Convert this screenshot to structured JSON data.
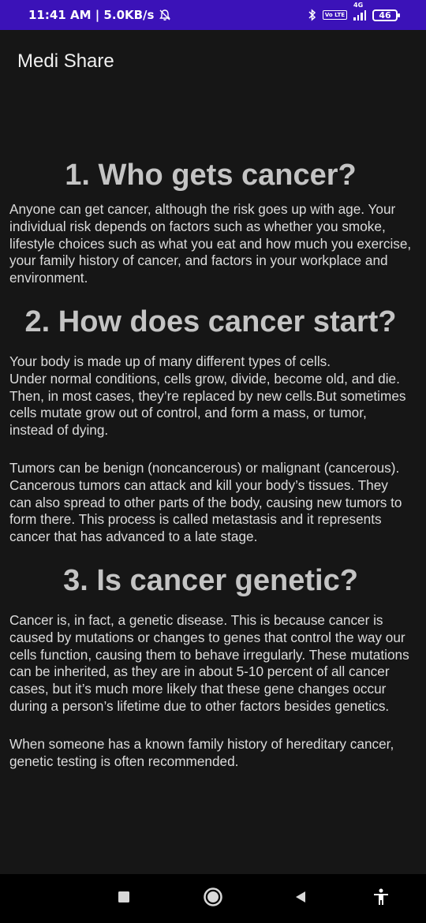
{
  "status_bar": {
    "time_speed": "11:41 AM | 5.0KB/s",
    "volte": "Vo LTE",
    "network": "4G",
    "battery": "46"
  },
  "app": {
    "title": "Medi Share"
  },
  "sections": [
    {
      "heading": "1. Who gets cancer?",
      "paragraphs": [
        "Anyone can get cancer, although the risk goes up with age. Your individual risk depends on factors such as whether you smoke, lifestyle choices such as what you eat and how much you exercise, your family history of cancer, and factors in your workplace and environment."
      ]
    },
    {
      "heading": "2. How does cancer start?",
      "paragraphs": [
        "Your body is made up of many different types of cells.\nUnder normal conditions, cells grow, divide, become old, and die. Then, in most cases, they’re replaced by new cells.But sometimes cells mutate grow out of control, and form a mass, or tumor, instead of dying.",
        "Tumors can be benign (noncancerous) or malignant (cancerous). Cancerous tumors can attack and kill your body’s tissues. They can also spread to other parts of the body, causing new tumors to form there. This process is called metastasis and it represents cancer that has advanced to a late stage."
      ]
    },
    {
      "heading": "3. Is cancer genetic?",
      "paragraphs": [
        "Cancer is, in fact, a genetic disease. This is because cancer is caused by mutations or changes to genes that control the way our cells function, causing them to behave irregularly. These mutations can be inherited, as they are in about 5-10 percent of all cancer cases, but it’s much more likely that these gene changes occur during a person’s lifetime due to other factors besides genetics.",
        "When someone has a known family history of hereditary cancer, genetic testing is often recommended."
      ]
    }
  ],
  "nav_bar": {
    "icons": [
      "recents-square-icon",
      "home-circle-icon",
      "back-triangle-icon",
      "accessibility-icon"
    ]
  },
  "colors": {
    "status_bar_bg": "#3b12b8",
    "background": "#161616",
    "heading": "#c4c4c4",
    "body_text": "#dcdcdc",
    "nav_bar_bg": "#000000"
  }
}
